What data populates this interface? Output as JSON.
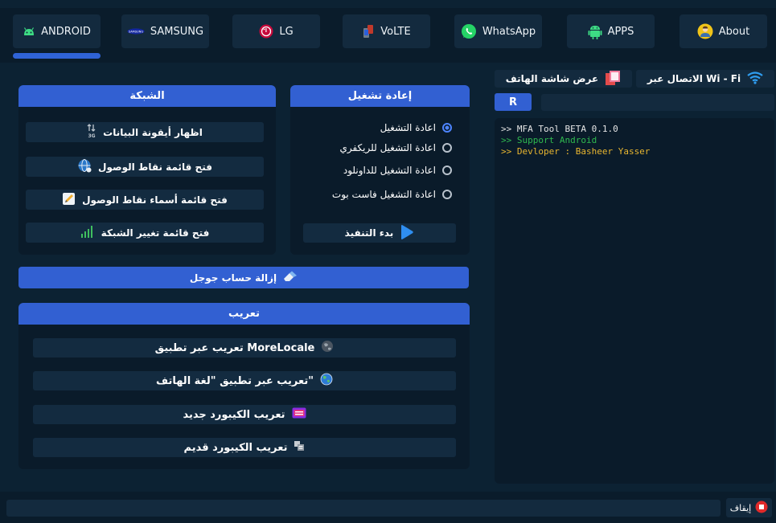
{
  "tabs": [
    {
      "label": "ANDROID",
      "icon": "android-icon",
      "active": true
    },
    {
      "label": "SAMSUNG",
      "icon": "samsung-logo-icon"
    },
    {
      "label": "LG",
      "icon": "lg-logo-icon"
    },
    {
      "label": "VoLTE",
      "icon": "volte-icon"
    },
    {
      "label": "WhatsApp",
      "icon": "whatsapp-icon"
    },
    {
      "label": "APPS",
      "icon": "android-apps-icon"
    },
    {
      "label": "About",
      "icon": "person-icon"
    }
  ],
  "network": {
    "title": "الشبكة",
    "buttons": [
      {
        "label": "اظهار أيقونة البيانات",
        "icon": "data-arrows-icon"
      },
      {
        "label": "فتح قائمة نقاط الوصول",
        "icon": "globe-network-icon"
      },
      {
        "label": "فتح قائمة أسماء نقاط الوصول",
        "icon": "pencil-icon"
      },
      {
        "label": "فتح قائمة تغيير الشبكة",
        "icon": "signal-bars-icon"
      }
    ]
  },
  "reboot": {
    "title": "إعادة تشغيل",
    "options": [
      {
        "label": "اعادة التشغيل",
        "checked": true
      },
      {
        "label": "اعادة التشغيل للريكفري",
        "checked": false
      },
      {
        "label": "اعادة التشغيل للداونلود",
        "checked": false
      },
      {
        "label": "اعادة التشغيل فاست بوت",
        "checked": false
      }
    ],
    "execute_label": "بدء التنفيذ"
  },
  "remove_google": {
    "label": "إزالة حساب جوجل",
    "icon": "eraser-icon"
  },
  "localize": {
    "title": "تعريب",
    "buttons": [
      {
        "label": "تعريب عبر تطبيق MoreLocale",
        "icon": "globe-dark-icon"
      },
      {
        "label": "تعريب عبر تطبيق \"لغة الهاتف\"",
        "icon": "globe-blue-icon"
      },
      {
        "label": "تعريب الكيبورد جديد",
        "icon": "keyboard-color-icon"
      },
      {
        "label": "تعريب الكيبورد قديم",
        "icon": "keyboard-grey-icon"
      }
    ]
  },
  "right_panel": {
    "wifi_label": "الاتصال عبر Wi - Fi",
    "screen_label": "عرض شاشة الهاتف",
    "r_label": "R",
    "input_value": ""
  },
  "console": {
    "lines": [
      {
        "text": ">> MFA Tool BETA 0.1.0",
        "color": "#e6e6e6"
      },
      {
        "text": ">> Support Android",
        "color": "#2fb94f"
      },
      {
        "text": ">> Devloper : Basheer Yasser",
        "color": "#e8b630"
      }
    ]
  },
  "status_bar": {
    "stop_label": "إيقاف",
    "input_value": ""
  }
}
